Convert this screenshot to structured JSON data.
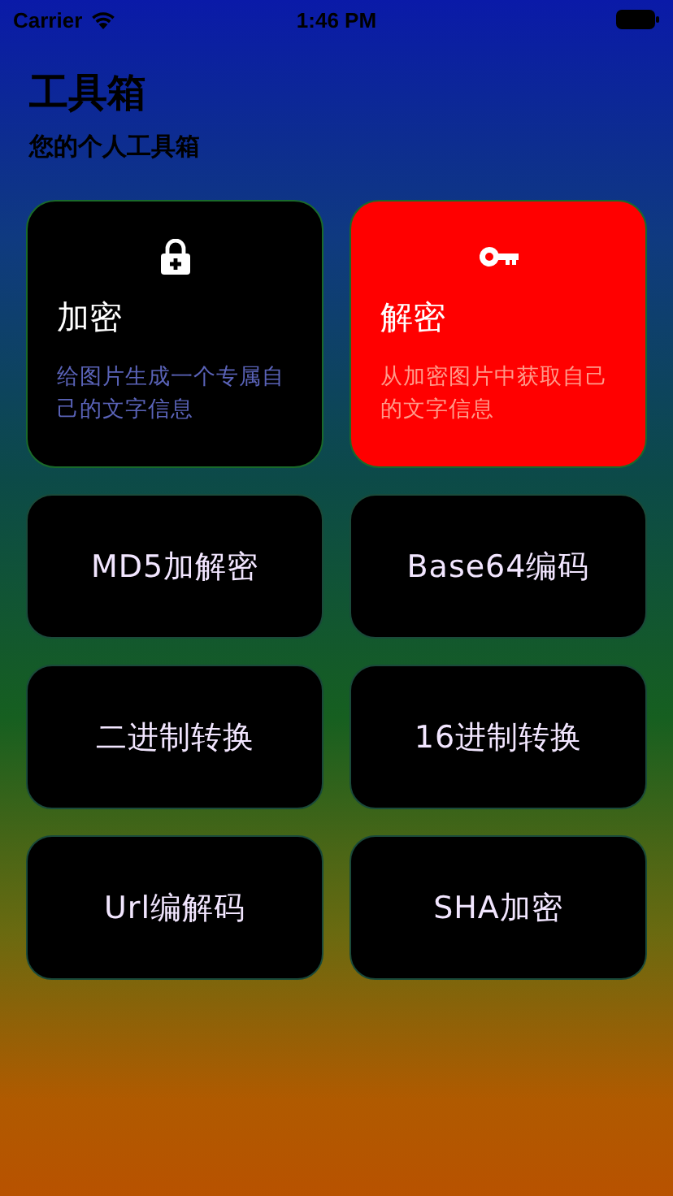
{
  "status_bar": {
    "carrier": "Carrier",
    "time": "1:46 PM"
  },
  "header": {
    "title": "工具箱",
    "subtitle": "您的个人工具箱"
  },
  "feature_cards": [
    {
      "kind": "lock",
      "title": "加密",
      "description": "给图片生成一个专属自己的文字信息",
      "color": "#000000"
    },
    {
      "kind": "key",
      "title": "解密",
      "description": "从加密图片中获取自己的文字信息",
      "color": "#ff0000"
    }
  ],
  "tool_buttons": [
    {
      "label": "MD5加解密"
    },
    {
      "label": "Base64编码"
    },
    {
      "label": "二进制转换"
    },
    {
      "label": "16进制转换"
    },
    {
      "label": "Url编解码"
    },
    {
      "label": "SHA加密"
    }
  ]
}
